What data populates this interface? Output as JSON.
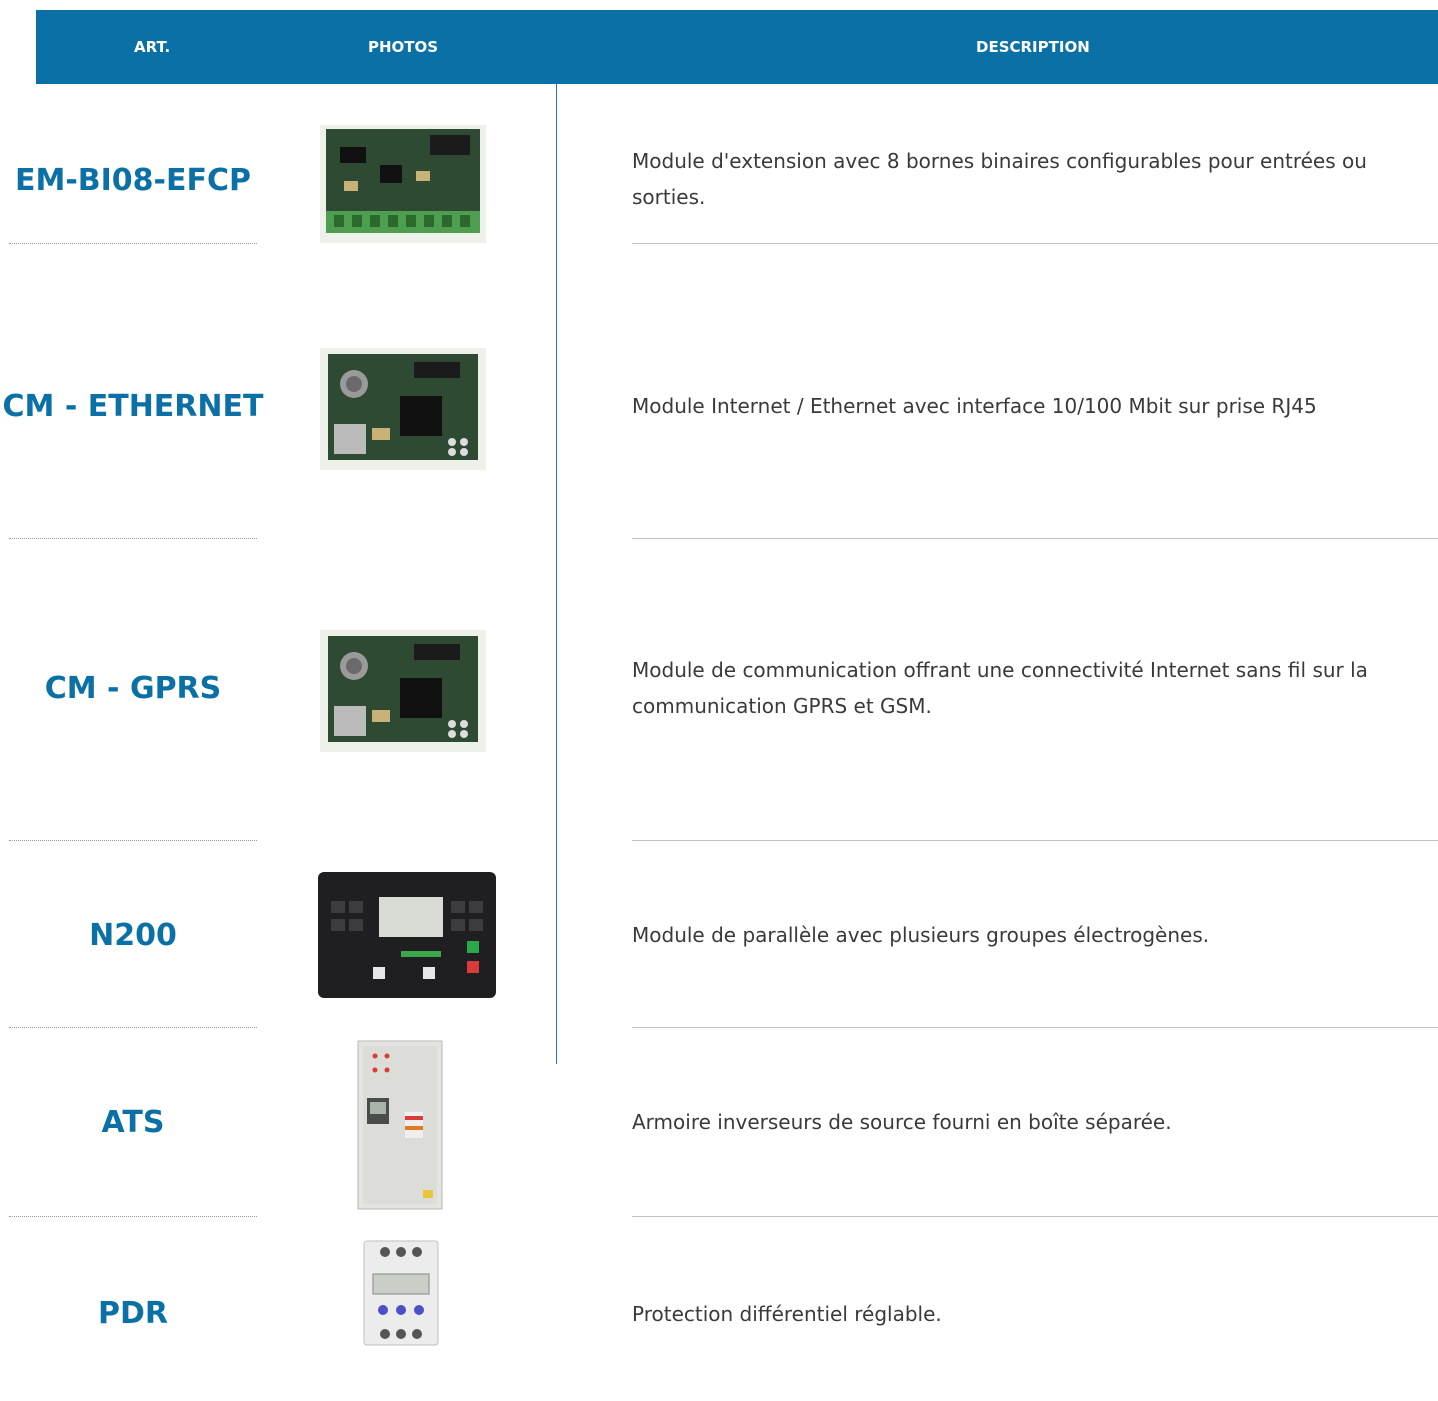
{
  "header": {
    "art": "ART.",
    "photos": "PHOTOS",
    "description": "DESCRIPTION"
  },
  "rows": [
    {
      "art": "EM-BI08-EFCP",
      "description": "Module d'extension avec 8 bornes binaires configurables pour entrées ou sorties.",
      "photo_icon": "expansion-board-icon"
    },
    {
      "art": "CM - ETHERNET",
      "description": "Module Internet / Ethernet avec interface 10/100 Mbit sur prise RJ45",
      "photo_icon": "ethernet-board-icon"
    },
    {
      "art": "CM - GPRS",
      "description": "Module de communication offrant une connectivité Internet sans fil sur la communication GPRS et GSM.",
      "photo_icon": "gprs-board-icon"
    },
    {
      "art": "N200",
      "description": "Module de parallèle avec plusieurs groupes électrogènes.",
      "photo_icon": "controller-panel-icon"
    },
    {
      "art": "ATS",
      "description": "Armoire inverseurs de source fourni en boîte séparée.",
      "photo_icon": "switch-cabinet-icon"
    },
    {
      "art": "PDR",
      "description": "Protection différentiel réglable.",
      "photo_icon": "differential-relay-icon"
    }
  ],
  "colors": {
    "header_bg": "#0a70a6",
    "accent": "#0a70a6",
    "text": "#3a3a3a"
  }
}
